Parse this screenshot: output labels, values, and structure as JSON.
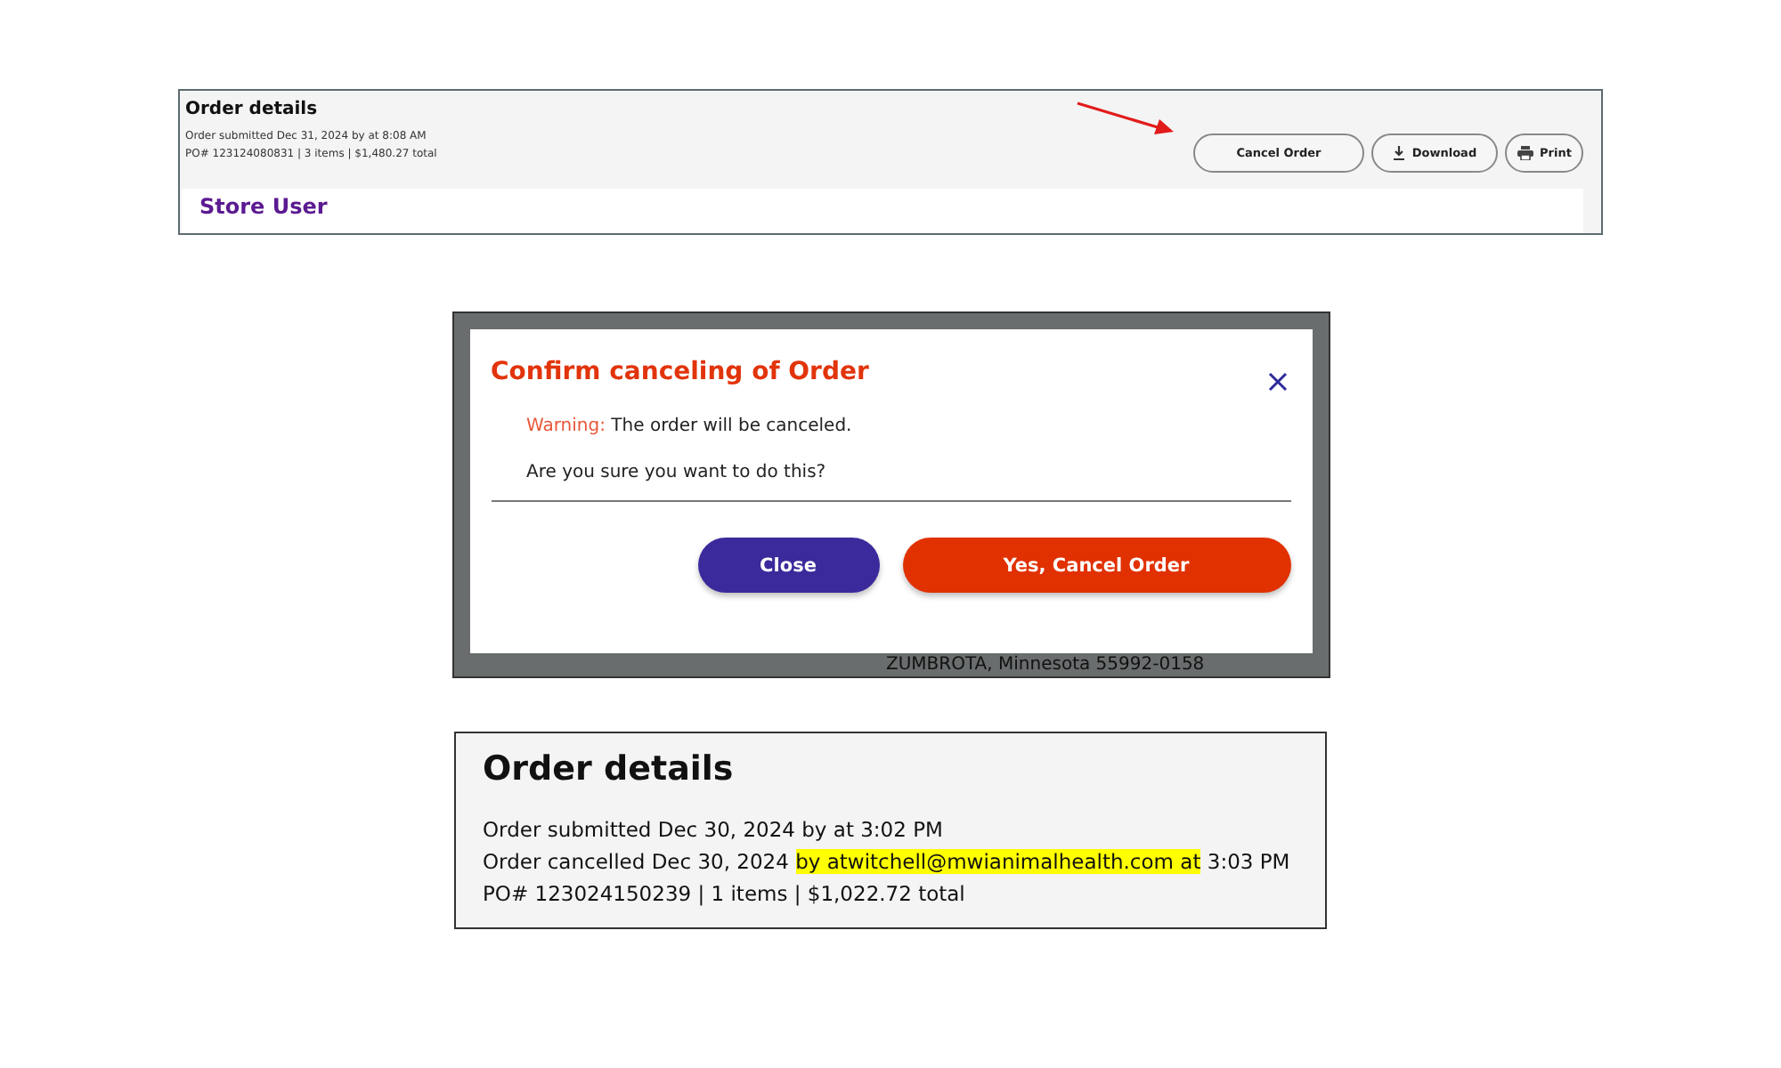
{
  "order_header": {
    "title": "Order details",
    "lines": [
      "Order submitted Dec 31, 2024 by at 8:08 AM",
      "PO# 123124080831 | 3 items | $1,480.27 total"
    ],
    "buttons": [
      {
        "label": "Cancel Order"
      },
      {
        "label": "Download"
      },
      {
        "label": "Print"
      }
    ],
    "card_title": "Store User"
  },
  "cancel_dialog": {
    "title": "Confirm canceling of Order",
    "warning_label": "Warning:",
    "warning_text": "The order will be canceled.",
    "question": "Are you sure you want to do this?",
    "buttons": [
      {
        "label": "Close",
        "kind": "secondary"
      },
      {
        "label": "Yes, Cancel Order",
        "kind": "primary"
      }
    ],
    "background_text": "ZUMBROTA, Minnesota 55992-0158"
  },
  "cancelled_order": {
    "title": "Order details",
    "lines": [
      [
        {
          "text": "Order submitted Dec 30, 2024 by at 3:02 PM",
          "highlighted": false
        }
      ],
      [
        {
          "text": "Order cancelled Dec 30, 2024 ",
          "highlighted": false
        },
        {
          "text": "by atwitchell@mwianimalhealth.com at",
          "highlighted": true
        },
        {
          "text": " 3:03 PM",
          "highlighted": false
        }
      ],
      [
        {
          "text": "PO# 123024150239 | 1 items | $1,022.72 total",
          "highlighted": false
        }
      ]
    ]
  }
}
